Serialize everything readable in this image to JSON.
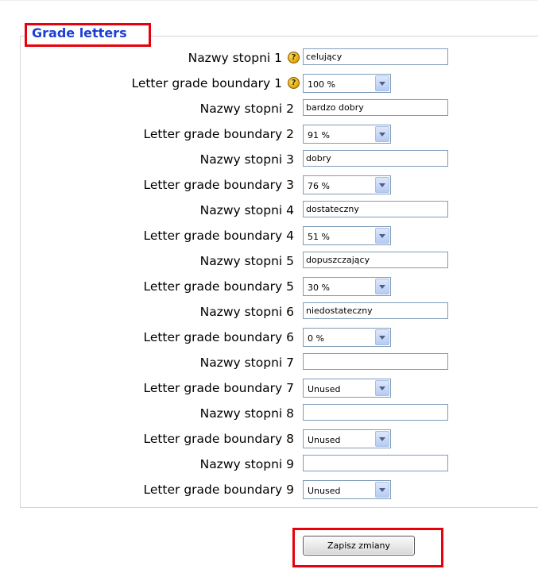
{
  "legend": "Grade letters",
  "rows": [
    {
      "name_label": "Nazwy stopni 1",
      "name_value": "celujący",
      "boundary_label": "Letter grade boundary 1",
      "boundary_value": "100 %",
      "has_help": true
    },
    {
      "name_label": "Nazwy stopni 2",
      "name_value": "bardzo dobry",
      "boundary_label": "Letter grade boundary 2",
      "boundary_value": "91 %",
      "has_help": false
    },
    {
      "name_label": "Nazwy stopni 3",
      "name_value": "dobry",
      "boundary_label": "Letter grade boundary 3",
      "boundary_value": "76 %",
      "has_help": false
    },
    {
      "name_label": "Nazwy stopni 4",
      "name_value": "dostateczny",
      "boundary_label": "Letter grade boundary 4",
      "boundary_value": "51 %",
      "has_help": false
    },
    {
      "name_label": "Nazwy stopni 5",
      "name_value": "dopuszczający",
      "boundary_label": "Letter grade boundary 5",
      "boundary_value": "30 %",
      "has_help": false
    },
    {
      "name_label": "Nazwy stopni 6",
      "name_value": "niedostateczny",
      "boundary_label": "Letter grade boundary 6",
      "boundary_value": "0 %",
      "has_help": false
    },
    {
      "name_label": "Nazwy stopni 7",
      "name_value": "",
      "boundary_label": "Letter grade boundary 7",
      "boundary_value": "Unused",
      "has_help": false
    },
    {
      "name_label": "Nazwy stopni 8",
      "name_value": "",
      "boundary_label": "Letter grade boundary 8",
      "boundary_value": "Unused",
      "has_help": false
    },
    {
      "name_label": "Nazwy stopni 9",
      "name_value": "",
      "boundary_label": "Letter grade boundary 9",
      "boundary_value": "Unused",
      "has_help": false
    }
  ],
  "help_glyph": "?",
  "submit_label": "Zapisz zmiany",
  "colors": {
    "legend": "#1a3fd6",
    "highlight": "#e8000a",
    "input_border": "#7f9db9"
  }
}
